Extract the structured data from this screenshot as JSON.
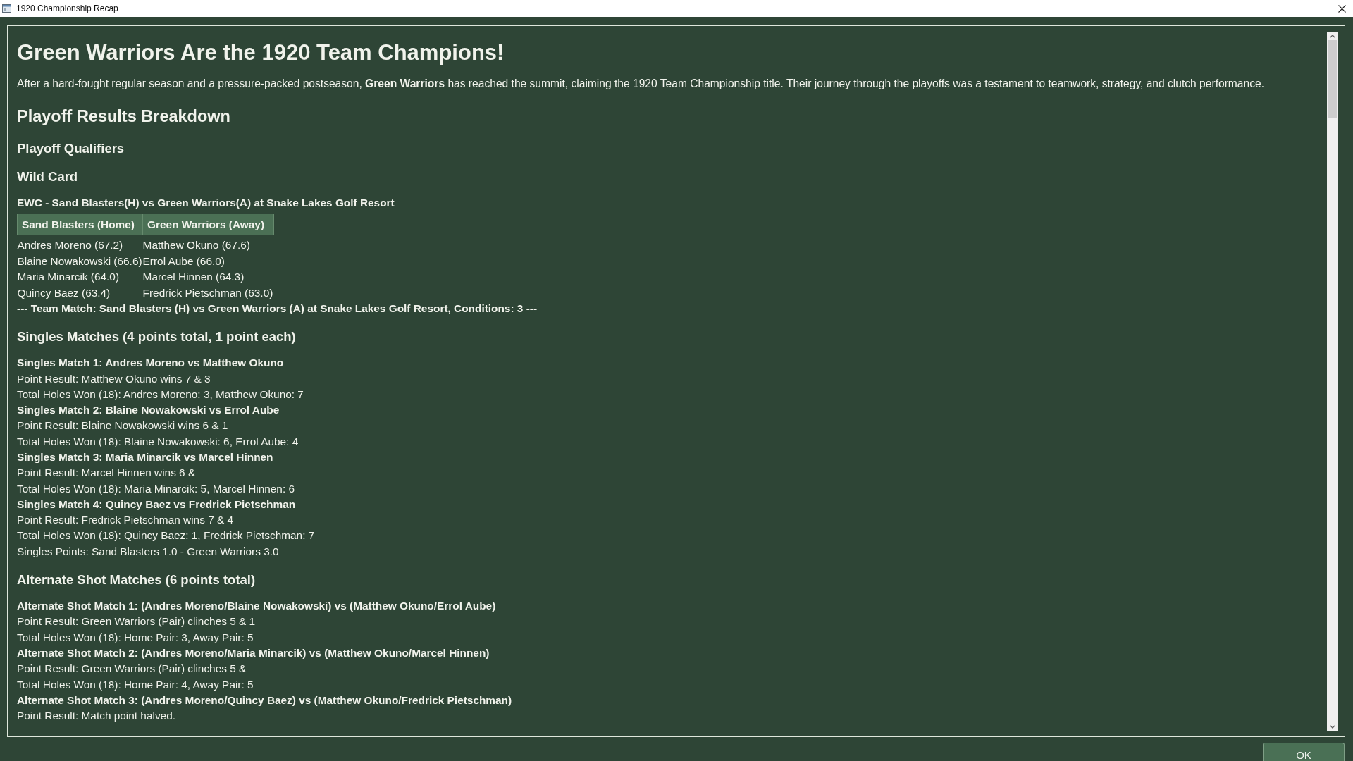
{
  "window": {
    "title": "1920 Championship Recap"
  },
  "report": {
    "blocks": [
      {
        "kind": "h1",
        "text": "Green Warriors Are the 1920 Team Champions!"
      },
      {
        "kind": "paragraph",
        "text": "After a hard-fought regular season and a pressure-packed postseason, **Green Warriors** has reached the summit, claiming the 1920 Team Championship title. Their journey through the playoffs was a testament to teamwork, strategy, and clutch performance."
      },
      {
        "kind": "h2",
        "text": "Playoff Results Breakdown"
      },
      {
        "kind": "h3",
        "text": "Playoff Qualifiers"
      },
      {
        "kind": "h3",
        "text": "Wild Card"
      },
      {
        "kind": "strong",
        "text": "EWC - Sand Blasters(H) vs Green Warriors(A) at Snake Lakes Golf Resort"
      },
      {
        "kind": "table",
        "columns": [
          "Sand Blasters (Home)",
          "Green Warriors (Away)"
        ],
        "rows": [
          [
            "Andres Moreno (67.2)",
            "Matthew Okuno (67.6)"
          ],
          [
            "Blaine Nowakowski (66.6)",
            "Errol Aube (66.0)"
          ],
          [
            "Maria Minarcik (64.0)",
            "Marcel Hinnen (64.3)"
          ],
          [
            "Quincy Baez (63.4)",
            "Fredrick Pietschman (63.0)"
          ]
        ]
      },
      {
        "kind": "strong",
        "text": "--- Team Match: Sand Blasters (H) vs Green Warriors (A) at Snake Lakes Golf Resort, Conditions: 3 ---"
      },
      {
        "kind": "h3",
        "text": "Singles Matches (4 points total, 1 point each)"
      },
      {
        "kind": "strong",
        "text": "Singles Match 1: Andres Moreno vs Matthew Okuno"
      },
      {
        "kind": "text",
        "text": "Point Result: Matthew Okuno wins 7 & 3"
      },
      {
        "kind": "text",
        "text": "Total Holes Won (18): Andres Moreno: 3, Matthew Okuno: 7"
      },
      {
        "kind": "strong",
        "text": "Singles Match 2: Blaine Nowakowski vs Errol Aube"
      },
      {
        "kind": "text",
        "text": "Point Result: Blaine Nowakowski wins 6 & 1"
      },
      {
        "kind": "text",
        "text": "Total Holes Won (18): Blaine Nowakowski: 6, Errol Aube: 4"
      },
      {
        "kind": "strong",
        "text": "Singles Match 3: Maria Minarcik vs Marcel Hinnen"
      },
      {
        "kind": "text",
        "text": "Point Result: Marcel Hinnen wins 6 &"
      },
      {
        "kind": "text",
        "text": "Total Holes Won (18): Maria Minarcik: 5, Marcel Hinnen: 6"
      },
      {
        "kind": "strong",
        "text": "Singles Match 4: Quincy Baez vs Fredrick Pietschman"
      },
      {
        "kind": "text",
        "text": "Point Result: Fredrick Pietschman wins 7 & 4"
      },
      {
        "kind": "text",
        "text": "Total Holes Won (18): Quincy Baez: 1, Fredrick Pietschman: 7"
      },
      {
        "kind": "text",
        "text": "Singles Points: Sand Blasters 1.0 - Green Warriors 3.0"
      },
      {
        "kind": "h3",
        "text": "Alternate Shot Matches (6 points total)"
      },
      {
        "kind": "strong",
        "text": "Alternate Shot Match 1: (Andres Moreno/Blaine Nowakowski) vs (Matthew Okuno/Errol Aube)"
      },
      {
        "kind": "text",
        "text": "Point Result: Green Warriors (Pair) clinches 5 & 1"
      },
      {
        "kind": "text",
        "text": "Total Holes Won (18): Home Pair: 3, Away Pair: 5"
      },
      {
        "kind": "strong",
        "text": "Alternate Shot Match 2: (Andres Moreno/Maria Minarcik) vs (Matthew Okuno/Marcel Hinnen)"
      },
      {
        "kind": "text",
        "text": "Point Result: Green Warriors (Pair) clinches 5 &"
      },
      {
        "kind": "text",
        "text": "Total Holes Won (18): Home Pair: 4, Away Pair: 5"
      },
      {
        "kind": "strong",
        "text": "Alternate Shot Match 3: (Andres Moreno/Quincy Baez) vs (Matthew Okuno/Fredrick Pietschman)"
      },
      {
        "kind": "text",
        "text": "Point Result: Match point halved."
      }
    ]
  },
  "buttons": [
    {
      "label": "OK"
    }
  ]
}
